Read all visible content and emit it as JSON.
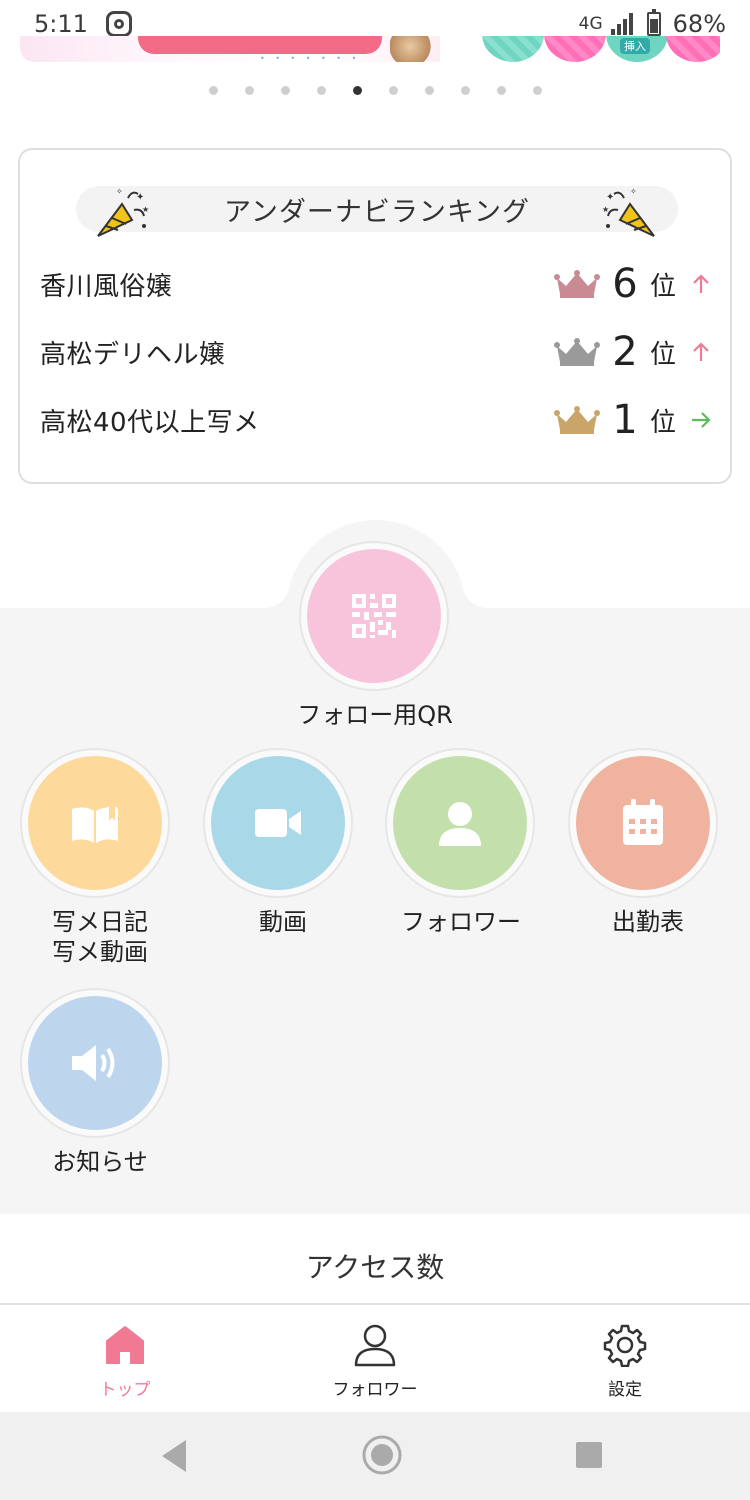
{
  "status_bar": {
    "time": "5:11",
    "network": "4G",
    "battery": "68%"
  },
  "carousel": {
    "dot_count": 10,
    "active_index": 4,
    "banner_tag": "挿入"
  },
  "ranking": {
    "title": "アンダーナビランキング",
    "rows": [
      {
        "label": "香川風俗嬢",
        "rank": "6",
        "unit": "位",
        "trend": "up",
        "crown_color": "#c98a93"
      },
      {
        "label": "高松デリヘル嬢",
        "rank": "2",
        "unit": "位",
        "trend": "up",
        "crown_color": "#9a9a9a"
      },
      {
        "label": "高松40代以上写メ",
        "rank": "1",
        "unit": "位",
        "trend": "flat",
        "crown_color": "#c9a56a"
      }
    ],
    "trend_up_color": "#f07a94",
    "trend_flat_color": "#5fba5f"
  },
  "menu": {
    "qr": {
      "label": "フォロー用QR",
      "icon": "qr-code-icon",
      "color": "#f7c4dc"
    },
    "items": [
      {
        "label": "写メ日記\n写メ動画",
        "icon": "open-book-icon",
        "color": "#fdd99c"
      },
      {
        "label": "動画",
        "icon": "video-camera-icon",
        "color": "#a9d8e8"
      },
      {
        "label": "フォロワー",
        "icon": "person-icon",
        "color": "#c3dfac"
      },
      {
        "label": "出勤表",
        "icon": "calendar-icon",
        "color": "#f0b39f"
      },
      {
        "label": "お知らせ",
        "icon": "speaker-icon",
        "color": "#bdd6ee"
      }
    ]
  },
  "access": {
    "title": "アクセス数"
  },
  "bottom_nav": {
    "items": [
      {
        "label": "トップ",
        "icon": "home-icon",
        "active": true
      },
      {
        "label": "フォロワー",
        "icon": "person-outline-icon",
        "active": false
      },
      {
        "label": "設定",
        "icon": "gear-icon",
        "active": false
      }
    ],
    "active_color": "#f07a94"
  },
  "system_nav": {
    "buttons": [
      "back-icon",
      "home-circle-icon",
      "recents-icon"
    ]
  }
}
